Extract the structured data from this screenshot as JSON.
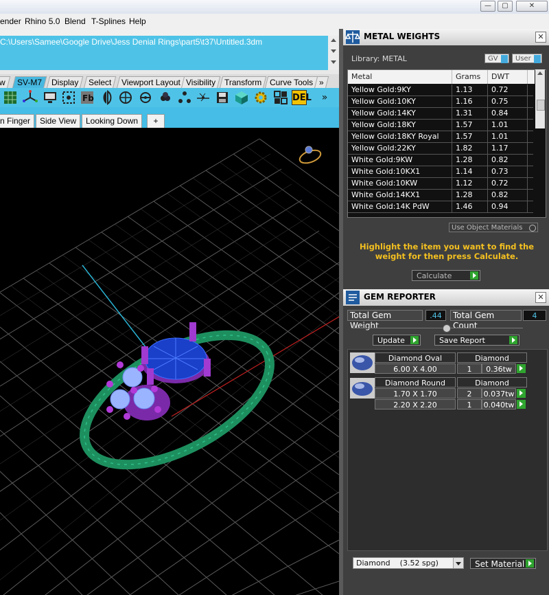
{
  "window": {
    "min": "—",
    "max": "▢",
    "close": "✕"
  },
  "menu": {
    "items": [
      "ender",
      "Rhino 5.0",
      "Blend",
      "T-Splines",
      "Help"
    ]
  },
  "command": {
    "path": "C:\\Users\\Samee\\Google Drive\\Jess Denial Rings\\part5\\t37\\Untitled.3dm"
  },
  "toolbar_tabs": [
    "w",
    "SV-M7",
    "Display",
    "Select",
    "Viewport Layout",
    "Visibility",
    "Transform",
    "Curve Tools",
    "»"
  ],
  "toolbar_icons": [
    "grid-icon",
    "axes-icon",
    "monitor-icon",
    "target-icon",
    "fb-icon",
    "mirror-icon",
    "sphere-icon",
    "cluster-icon",
    "dots-icon",
    "network-icon",
    "save-icon",
    "cube-icon",
    "gear-icon",
    "layout-icon",
    "del-icon",
    "more-icon"
  ],
  "toolbar_more": "»",
  "toolbar_del": "DEL",
  "view_tabs": [
    "n Finger",
    "Side View",
    "Looking Down",
    "+"
  ],
  "metal_weights": {
    "title": "METAL WEIGHTS",
    "library_label": "Library: METAL",
    "gv_label": "GV",
    "user_label": "User",
    "columns": [
      "Metal",
      "Grams",
      "DWT"
    ],
    "rows": [
      [
        "Yellow Gold:9KY",
        "1.13",
        "0.72"
      ],
      [
        "Yellow Gold:10KY",
        "1.16",
        "0.75"
      ],
      [
        "Yellow Gold:14KY",
        "1.31",
        "0.84"
      ],
      [
        "Yellow Gold:18KY",
        "1.57",
        "1.01"
      ],
      [
        "Yellow Gold:18KY Royal",
        "1.57",
        "1.01"
      ],
      [
        "Yellow Gold:22KY",
        "1.82",
        "1.17"
      ],
      [
        "White Gold:9KW",
        "1.28",
        "0.82"
      ],
      [
        "White Gold:10KX1",
        "1.14",
        "0.73"
      ],
      [
        "White Gold:10KW",
        "1.12",
        "0.72"
      ],
      [
        "White Gold:14KX1",
        "1.28",
        "0.82"
      ],
      [
        "White Gold:14K PdW",
        "1.46",
        "0.94"
      ]
    ],
    "use_object_materials": "Use Object Materials",
    "hint": "Highlight the item you want to find the weight for then press Calculate.",
    "calculate": "Calculate"
  },
  "gem_reporter": {
    "title": "GEM REPORTER",
    "total_gem_weight_label": "Total Gem Weight",
    "total_gem_weight": ".44",
    "total_gem_count_label": "Total Gem Count",
    "total_gem_count": "4",
    "update": "Update",
    "save_report": "Save Report",
    "groups": [
      {
        "shape": "Diamond Oval",
        "material": "Diamond",
        "rows": [
          [
            "6.00 X 4.00",
            "1",
            "0.36tw"
          ]
        ]
      },
      {
        "shape": "Diamond Round",
        "material": "Diamond",
        "rows": [
          [
            "1.70 X 1.70",
            "2",
            "0.037tw"
          ],
          [
            "2.20 X 2.20",
            "1",
            "0.040tw"
          ]
        ]
      }
    ],
    "material_select": "Diamond    (3.52 spg)",
    "set_material": "Set Material"
  },
  "colors": {
    "accent": "#4fc3e7",
    "highlight_text": "#f4c020",
    "go_green": "#2fa42f"
  }
}
